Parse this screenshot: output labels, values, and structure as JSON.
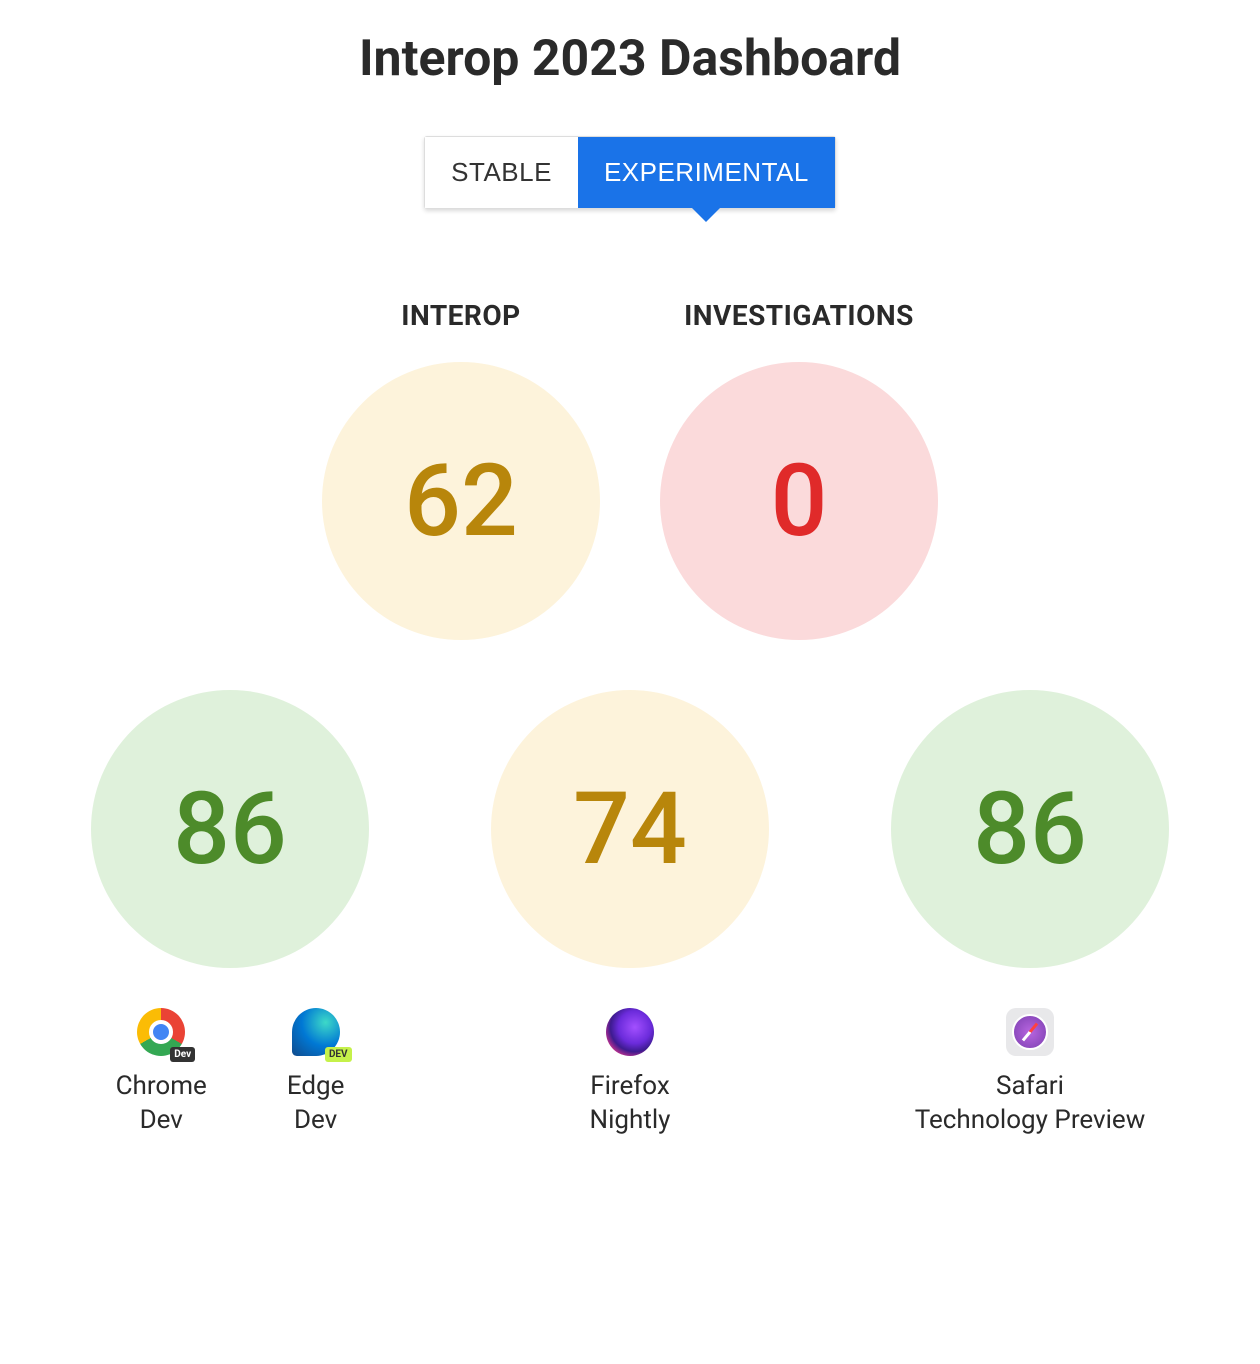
{
  "title": "Interop 2023 Dashboard",
  "toggle": {
    "stable": "STABLE",
    "experimental": "EXPERIMENTAL",
    "active": "experimental"
  },
  "summary": {
    "interop": {
      "label": "INTEROP",
      "value": "62",
      "color": "yellow"
    },
    "investigations": {
      "label": "INVESTIGATIONS",
      "value": "0",
      "color": "red"
    }
  },
  "browsers": [
    {
      "score": "86",
      "color": "green",
      "items": [
        {
          "id": "chrome-dev",
          "name": "Chrome\nDev",
          "icon": "chrome-dev-icon",
          "badge": "Dev"
        },
        {
          "id": "edge-dev",
          "name": "Edge\nDev",
          "icon": "edge-dev-icon",
          "badge": "DEV"
        }
      ]
    },
    {
      "score": "74",
      "color": "yellow",
      "items": [
        {
          "id": "firefox-nightly",
          "name": "Firefox\nNightly",
          "icon": "firefox-nightly-icon"
        }
      ]
    },
    {
      "score": "86",
      "color": "green",
      "items": [
        {
          "id": "safari-tp",
          "name": "Safari\nTechnology Preview",
          "icon": "safari-tp-icon"
        }
      ]
    }
  ]
}
